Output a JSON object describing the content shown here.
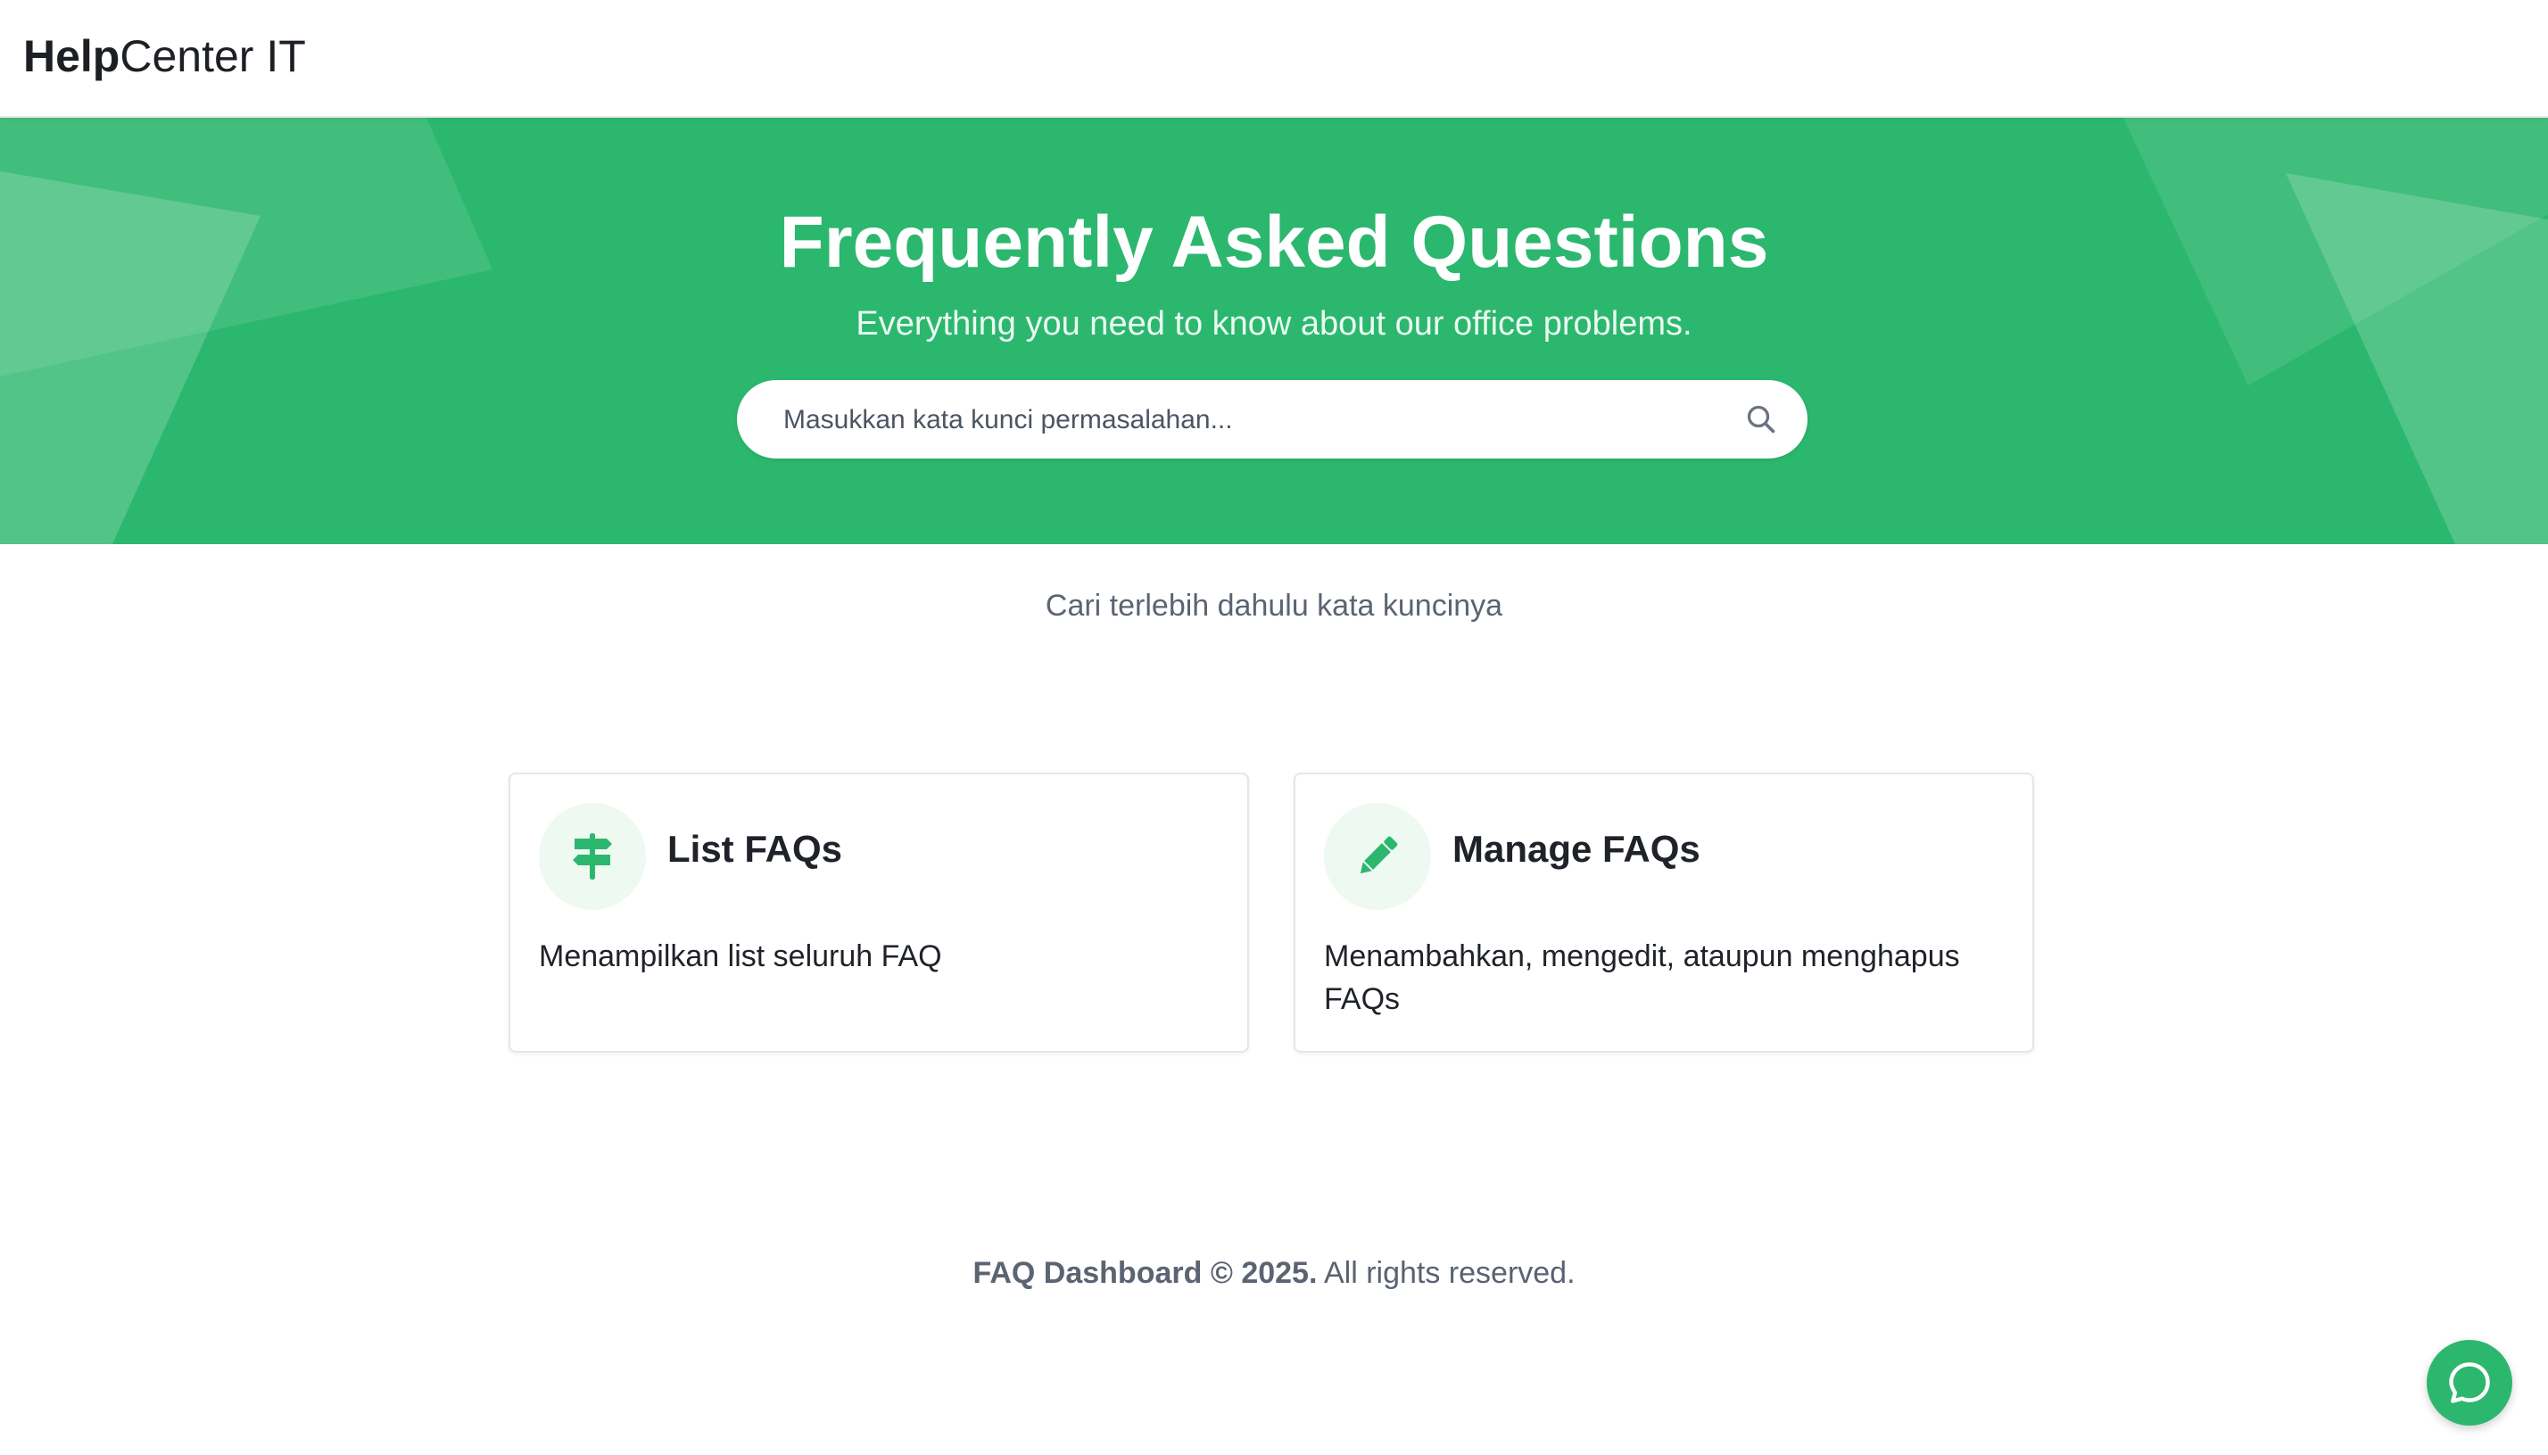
{
  "header": {
    "logo_strong": "Help",
    "logo_light": "Center IT"
  },
  "hero": {
    "title": "Frequently Asked Questions",
    "subtitle": "Everything you need to know about our office problems.",
    "search": {
      "placeholder": "Masukkan kata kunci permasalahan...",
      "value": "",
      "icon": "search-icon"
    }
  },
  "hint": "Cari terlebih dahulu kata kuncinya",
  "cards": [
    {
      "title": "List FAQs",
      "description": "Menampilkan list seluruh FAQ",
      "icon": "signpost-icon"
    },
    {
      "title": "Manage FAQs",
      "description": "Menambahkan, mengedit, ataupun menghapus FAQs",
      "icon": "pencil-icon"
    }
  ],
  "footer": {
    "brand": "FAQ Dashboard © 2025.",
    "text": "All rights reserved."
  },
  "chat": {
    "icon": "chat-bubble-icon"
  },
  "colors": {
    "primary": "#2cb76e",
    "icon_bg": "#eef9f2",
    "text_dark": "#1f2329",
    "text_muted": "#5b6472"
  }
}
